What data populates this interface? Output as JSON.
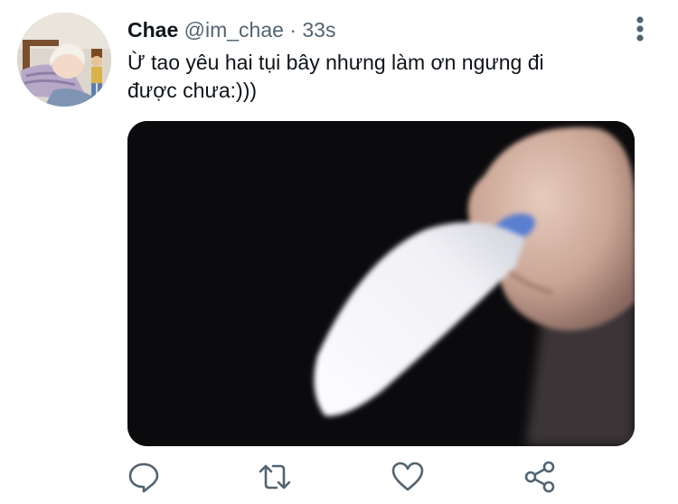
{
  "tweet": {
    "author": {
      "display_name": "Chae",
      "handle": "@im_chae"
    },
    "separator": "·",
    "timestamp": "33s",
    "text_lines": [
      "Ừ tao yêu hai tụi bây nhưng làm ơn ngưng đi",
      "được chưa:)))"
    ]
  },
  "icons": {
    "more": "more-vertical-icon",
    "reply": "reply-icon",
    "retweet": "retweet-icon",
    "like": "heart-icon",
    "share": "share-icon"
  },
  "colors": {
    "icon": "#536471",
    "text": "#0f1419",
    "secondary": "#536471",
    "media_background": "#0b0a0c"
  }
}
